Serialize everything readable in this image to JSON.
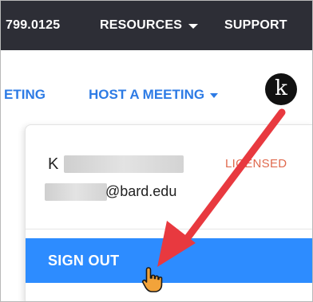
{
  "topbar": {
    "phone": "799.0125",
    "resources": "RESOURCES",
    "support": "SUPPORT"
  },
  "nav": {
    "join_partial": "ETING",
    "host": "HOST A MEETING",
    "avatar_letter": "k"
  },
  "dropdown": {
    "user_name_initial": "K",
    "license": "LICENSED",
    "email_suffix": "@bard.edu",
    "sign_out": "SIGN OUT"
  },
  "colors": {
    "topbar_bg": "#2d2e36",
    "link_blue": "#2d7be5",
    "signout_bg": "#2d8cff",
    "licensed_orange": "#e06a4e",
    "annotation_red": "#e8393f"
  },
  "icons": {
    "resources_caret": "chevron-down-icon",
    "host_caret": "chevron-down-icon",
    "cursor": "hand-pointer-icon",
    "annotation": "red-arrow-icon"
  }
}
